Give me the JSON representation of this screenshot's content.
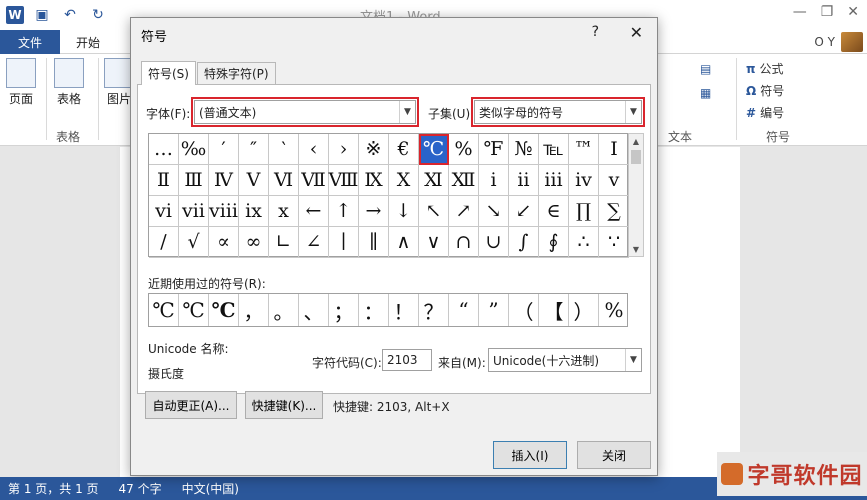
{
  "word": {
    "logo": "W",
    "doc_title": "文档1 - Word",
    "tabs": {
      "file": "文件",
      "home": "开始"
    },
    "user": "O Y",
    "ribbon": {
      "pages": "页面",
      "table": "表格",
      "picture": "图片",
      "table_group": "表格",
      "equation": "公式",
      "symbol": "符号",
      "numbering": "编号",
      "text_group": "文本",
      "symbols_group": "符号"
    },
    "status": {
      "page": "第 1 页，共 1 页",
      "words": "47 个字",
      "lang": "中文(中国)"
    },
    "watermark": "字哥软件园"
  },
  "dialog": {
    "title": "符号",
    "help": "?",
    "close": "✕",
    "tabs": {
      "symbols": "符号(S)",
      "special": "特殊字符(P)"
    },
    "font_label": "字体(F):",
    "font_value": "(普通文本)",
    "subset_label": "子集(U):",
    "subset_value": "类似字母的符号",
    "symbols": [
      "…",
      "‰",
      "′",
      "″",
      "‵",
      "‹",
      "›",
      "※",
      "€",
      "℃",
      "%",
      "℉",
      "№",
      "℡",
      "™",
      "Ⅰ",
      "Ⅱ",
      "Ⅲ",
      "Ⅳ",
      "Ⅴ",
      "Ⅵ",
      "Ⅶ",
      "Ⅷ",
      "Ⅸ",
      "Ⅹ",
      "Ⅺ",
      "Ⅻ",
      "ⅰ",
      "ⅱ",
      "ⅲ",
      "ⅳ",
      "ⅴ",
      "ⅵ",
      "ⅶ",
      "ⅷ",
      "ⅸ",
      "ⅹ",
      "←",
      "↑",
      "→",
      "↓",
      "↖",
      "↗",
      "↘",
      "↙",
      "∈",
      "∏",
      "∑",
      "∕",
      "√",
      "∝",
      "∞",
      "∟",
      "∠",
      "∣",
      "∥",
      "∧",
      "∨",
      "∩",
      "∪",
      "∫",
      "∮",
      "∴",
      "∵"
    ],
    "recent_label": "近期使用过的符号(R):",
    "recent_symbols": [
      "℃",
      "℃",
      "℃",
      "，",
      "。",
      "、",
      "；",
      "：",
      "！",
      "？",
      "“",
      "”",
      "（",
      "【",
      "）",
      "%"
    ],
    "unicode_name_label": "Unicode 名称:",
    "unicode_name": "摄氏度",
    "char_code_label": "字符代码(C):",
    "char_code": "2103",
    "from_label": "来自(M):",
    "from_value": "Unicode(十六进制)",
    "autocorrect_button": "自动更正(A)...",
    "shortcut_button": "快捷键(K)...",
    "shortcut_text": "快捷键: 2103, Alt+X",
    "insert_button": "插入(I)",
    "close_button": "关闭"
  },
  "colors": {
    "accent": "#2b579a",
    "highlight": "#d9252d",
    "selection": "#2a63c9"
  }
}
